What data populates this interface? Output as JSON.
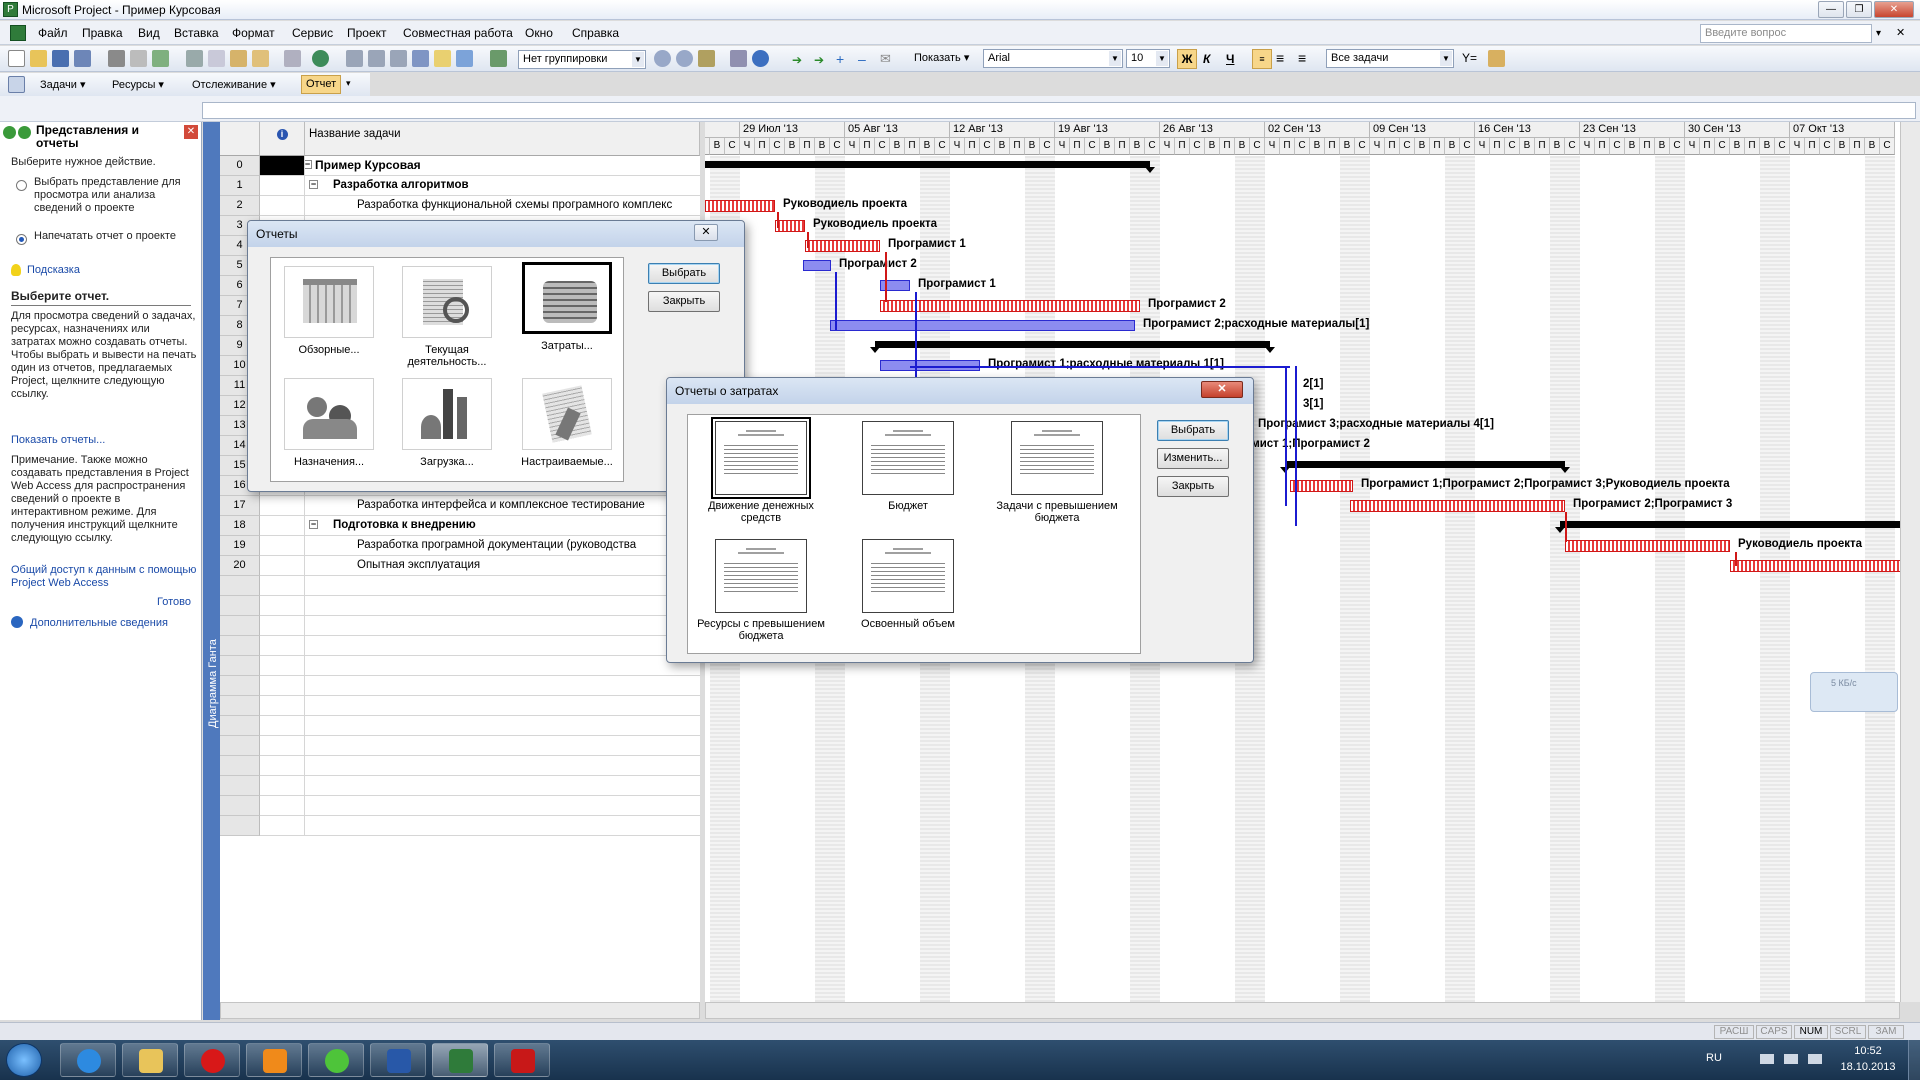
{
  "window": {
    "title": "Microsoft Project - Пример Курсовая"
  },
  "menu": [
    "Файл",
    "Правка",
    "Вид",
    "Вставка",
    "Формат",
    "Сервис",
    "Проект",
    "Совместная работа",
    "Окно",
    "Справка"
  ],
  "help_placeholder": "Введите вопрос",
  "toolbar1": {
    "grouping": "Нет группировки",
    "show": "Показать",
    "font": "Arial",
    "size": "10",
    "bold": "Ж",
    "italic": "К",
    "underline": "Ч",
    "filter": "Все задачи"
  },
  "toolbar2": {
    "tasks": "Задачи",
    "resources": "Ресурсы",
    "tracking": "Отслеживание",
    "report": "Отчет"
  },
  "taskpane": {
    "title": "Представления и отчеты",
    "prompt": "Выберите нужное действие.",
    "option1": "Выбрать представление для просмотра или анализа сведений о проекте",
    "option2": "Напечатать отчет о проекте",
    "hint": "Подсказка",
    "heading": "Выберите отчет.",
    "body1": "Для просмотра сведений о задачах, ресурсах, назначениях или затратах можно создавать отчеты. Чтобы выбрать и вывести на печать один из отчетов, предлагаемых Project, щелкните следующую ссылку.",
    "link1": "Показать отчеты...",
    "body2": "Примечание. Также можно создавать представления в Project Web Access для распространения сведений о проекте в интерактивном режиме. Для получения инструкций щелкните следующую ссылку.",
    "link2": "Общий доступ к данным с помощью Project Web Access",
    "done": "Готово",
    "more": "Дополнительные сведения"
  },
  "viewbar_label": "Диаграмма Ганта",
  "table": {
    "col_name": "Название задачи",
    "rows": [
      {
        "id": "0",
        "name": "Пример Курсовая"
      },
      {
        "id": "1",
        "name": "Разработка алгоритмов"
      },
      {
        "id": "2",
        "name": "Разработка функциональной схемы програмного комплекс"
      },
      {
        "id": "3",
        "name": ""
      },
      {
        "id": "4",
        "name": ""
      },
      {
        "id": "5",
        "name": ""
      },
      {
        "id": "6",
        "name": ""
      },
      {
        "id": "7",
        "name": ""
      },
      {
        "id": "8",
        "name": ""
      },
      {
        "id": "9",
        "name": ""
      },
      {
        "id": "10",
        "name": ""
      },
      {
        "id": "11",
        "name": ""
      },
      {
        "id": "12",
        "name": ""
      },
      {
        "id": "13",
        "name": ""
      },
      {
        "id": "14",
        "name": ""
      },
      {
        "id": "15",
        "name": ""
      },
      {
        "id": "16",
        "name": ""
      },
      {
        "id": "17",
        "name": "Разработка интерфейса и комплексное тестирование"
      },
      {
        "id": "18",
        "name": "Подготовка к внедрению"
      },
      {
        "id": "19",
        "name": "Разработка програмной документации (руководства"
      },
      {
        "id": "20",
        "name": "Опытная эксплуатация"
      }
    ]
  },
  "gantt": {
    "weeks": [
      "'13",
      "29 Июл '13",
      "05 Авг '13",
      "12 Авг '13",
      "19 Авг '13",
      "26 Авг '13",
      "02 Сен '13",
      "09 Сен '13",
      "16 Сен '13",
      "23 Сен '13",
      "30 Сен '13",
      "07 Окт '13"
    ],
    "days": [
      "Ч",
      "П",
      "С",
      "В",
      "П",
      "В",
      "С",
      "Ч",
      "П",
      "С",
      "В",
      "П",
      "В",
      "С"
    ],
    "labels": {
      "l2": "Руководиель проекта",
      "l3": "Руководиель проекта",
      "l4": "Програмист 1",
      "l5": "Програмист 2",
      "l6": "Програмист 1",
      "l7": "Програмист 2",
      "l8": "Програмист 2;расходные материалы[1]",
      "l10": "Програмист 1;расходные материалы 1[1]",
      "l11": "2[1]",
      "l12": "3[1]",
      "l13": "Програмист 3;расходные материалы 4[1]",
      "l14": "грамист 1;Програмист 2",
      "l16": "Програмист 1;Програмист 2;Програмист 3;Руководиель проекта",
      "l17": "Програмист 2;Програмист 3",
      "l19": "Руководиель проекта"
    }
  },
  "dlg_reports": {
    "title": "Отчеты",
    "tiles": [
      "Обзорные...",
      "Текущая деятельность...",
      "Затраты...",
      "Назначения...",
      "Загрузка...",
      "Настраиваемые..."
    ],
    "select": "Выбрать",
    "close": "Закрыть"
  },
  "dlg_cost": {
    "title": "Отчеты о затратах",
    "tiles": [
      "Движение денежных средств",
      "Бюджет",
      "Задачи с превышением бюджета",
      "Ресурсы с превышением бюджета",
      "Освоенный объем"
    ],
    "select": "Выбрать",
    "edit": "Изменить...",
    "close": "Закрыть"
  },
  "netwidget": "5 КБ/с",
  "status": [
    "РАСШ",
    "CAPS",
    "NUM",
    "SCRL",
    "ЗАМ"
  ],
  "tray": {
    "lang": "RU",
    "time": "10:52",
    "date": "18.10.2013"
  },
  "colors": {
    "accent": "#4f79bd",
    "redbar": "#e83a3a",
    "bluebar": "#8c8cf0"
  }
}
